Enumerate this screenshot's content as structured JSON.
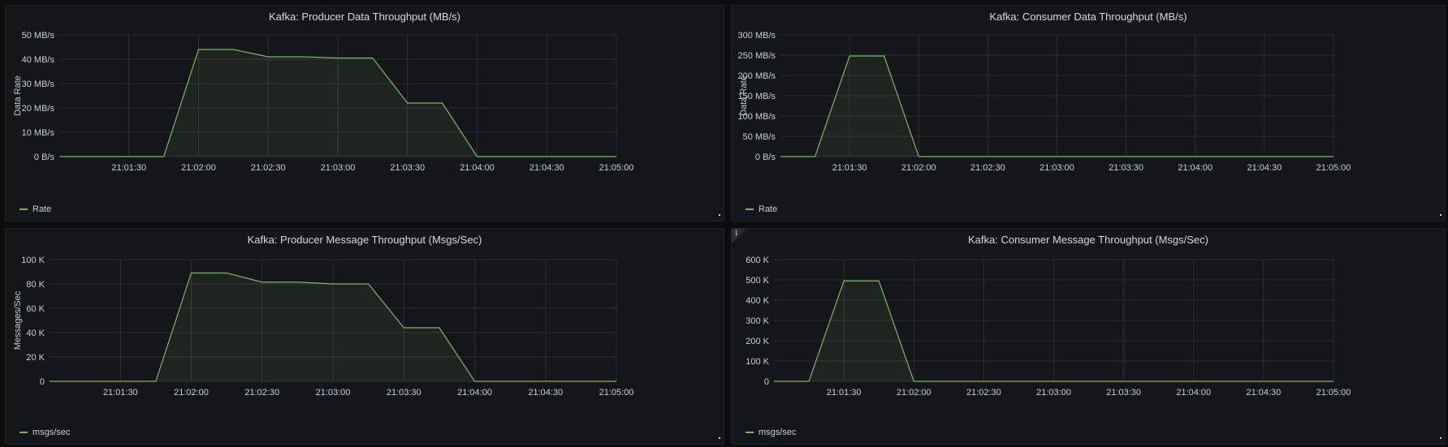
{
  "colors": {
    "series": "#7eb26d",
    "grid": "#2c2f34",
    "text": "#c7d0d9"
  },
  "chart_data": [
    {
      "type": "area",
      "title": "Kafka: Producer Data Throughput (MB/s)",
      "ylabel": "Data Rate",
      "xlabel": "",
      "x": [
        "21:01:00",
        "21:01:15",
        "21:01:30",
        "21:01:45",
        "21:02:00",
        "21:02:15",
        "21:02:30",
        "21:02:45",
        "21:03:00",
        "21:03:15",
        "21:03:30",
        "21:03:45",
        "21:04:00",
        "21:04:15",
        "21:04:30",
        "21:04:45",
        "21:05:00"
      ],
      "series": [
        {
          "name": "Rate",
          "values": [
            0,
            0,
            0,
            0,
            44,
            44,
            41,
            41,
            40.5,
            40.5,
            22,
            22,
            0,
            0,
            0,
            0,
            0
          ]
        }
      ],
      "yticks": [
        "0 B/s",
        "10 MB/s",
        "20 MB/s",
        "30 MB/s",
        "40 MB/s",
        "50 MB/s"
      ],
      "ylim": [
        0,
        50
      ],
      "xticks": [
        "21:01:30",
        "21:02:00",
        "21:02:30",
        "21:03:00",
        "21:03:30",
        "21:04:00",
        "21:04:30",
        "21:05:00"
      ],
      "legend": "bottom-left",
      "grid": true
    },
    {
      "type": "area",
      "title": "Kafka: Consumer Data Throughput (MB/s)",
      "ylabel": "Data Rate",
      "xlabel": "",
      "x": [
        "21:01:00",
        "21:01:15",
        "21:01:30",
        "21:01:45",
        "21:02:00",
        "21:02:15",
        "21:02:30",
        "21:02:45",
        "21:03:00",
        "21:03:15",
        "21:03:30",
        "21:03:45",
        "21:04:00",
        "21:04:15",
        "21:04:30",
        "21:04:45",
        "21:05:00"
      ],
      "series": [
        {
          "name": "Rate",
          "values": [
            0,
            0,
            248,
            248,
            0,
            0,
            0,
            0,
            0,
            0,
            0,
            0,
            0,
            0,
            0,
            0,
            0
          ]
        }
      ],
      "yticks": [
        "0 B/s",
        "50 MB/s",
        "100 MB/s",
        "150 MB/s",
        "200 MB/s",
        "250 MB/s",
        "300 MB/s"
      ],
      "ylim": [
        0,
        300
      ],
      "xticks": [
        "21:01:30",
        "21:02:00",
        "21:02:30",
        "21:03:00",
        "21:03:30",
        "21:04:00",
        "21:04:30",
        "21:05:00"
      ],
      "legend": "bottom-left",
      "grid": true
    },
    {
      "type": "area",
      "title": "Kafka: Producer Message Throughput (Msgs/Sec)",
      "ylabel": "Messages/Sec",
      "xlabel": "",
      "x": [
        "21:01:00",
        "21:01:15",
        "21:01:30",
        "21:01:45",
        "21:02:00",
        "21:02:15",
        "21:02:30",
        "21:02:45",
        "21:03:00",
        "21:03:15",
        "21:03:30",
        "21:03:45",
        "21:04:00",
        "21:04:15",
        "21:04:30",
        "21:04:45",
        "21:05:00"
      ],
      "series": [
        {
          "name": "msgs/sec",
          "values": [
            0,
            0,
            0,
            0,
            89000,
            89000,
            81500,
            81500,
            80000,
            80000,
            44000,
            44000,
            0,
            0,
            0,
            0,
            0
          ]
        }
      ],
      "yticks": [
        "0",
        "20 K",
        "40 K",
        "60 K",
        "80 K",
        "100 K"
      ],
      "ylim": [
        0,
        100000
      ],
      "xticks": [
        "21:01:30",
        "21:02:00",
        "21:02:30",
        "21:03:00",
        "21:03:30",
        "21:04:00",
        "21:04:30",
        "21:05:00"
      ],
      "legend": "bottom-left",
      "grid": true
    },
    {
      "type": "area",
      "title": "Kafka: Consumer Message Throughput (Msgs/Sec)",
      "ylabel": "",
      "xlabel": "",
      "x": [
        "21:01:00",
        "21:01:15",
        "21:01:30",
        "21:01:45",
        "21:02:00",
        "21:02:15",
        "21:02:30",
        "21:02:45",
        "21:03:00",
        "21:03:15",
        "21:03:30",
        "21:03:45",
        "21:04:00",
        "21:04:15",
        "21:04:30",
        "21:04:45",
        "21:05:00"
      ],
      "series": [
        {
          "name": "msgs/sec",
          "values": [
            0,
            0,
            495000,
            495000,
            0,
            0,
            0,
            0,
            0,
            0,
            0,
            0,
            0,
            0,
            0,
            0,
            0
          ]
        }
      ],
      "yticks": [
        "0",
        "100 K",
        "200 K",
        "300 K",
        "400 K",
        "500 K",
        "600 K"
      ],
      "ylim": [
        0,
        600000
      ],
      "xticks": [
        "21:01:30",
        "21:02:00",
        "21:02:30",
        "21:03:00",
        "21:03:30",
        "21:04:00",
        "21:04:30",
        "21:05:00"
      ],
      "legend": "bottom-left",
      "grid": true
    }
  ],
  "panels": [
    {
      "info_icon": false
    },
    {
      "info_icon": false
    },
    {
      "info_icon": false
    },
    {
      "info_icon": true,
      "info_glyph": "i"
    }
  ]
}
